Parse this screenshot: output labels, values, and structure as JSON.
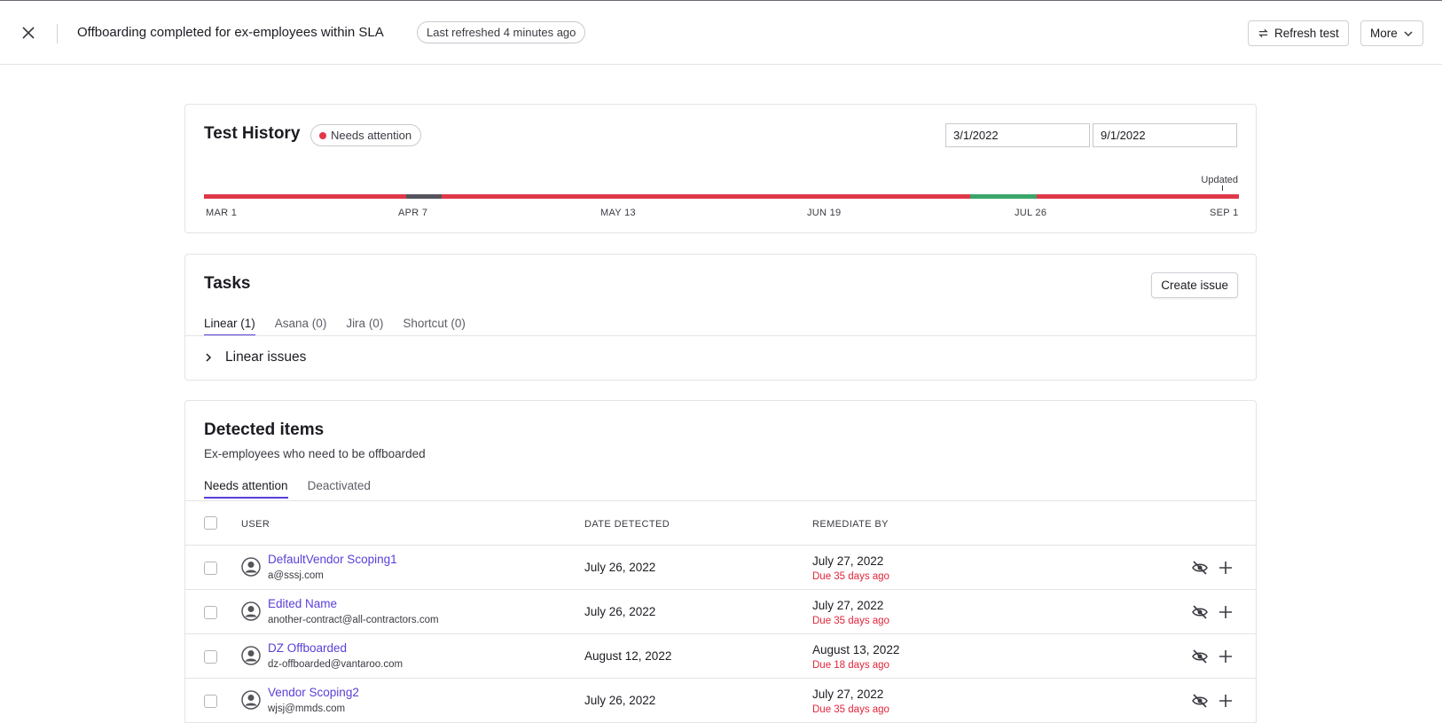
{
  "header": {
    "title": "Offboarding completed for ex-employees within SLA",
    "refresh_status": "Last refreshed 4 minutes ago",
    "refresh_button": "Refresh test",
    "more_button": "More"
  },
  "history": {
    "title": "Test History",
    "status": "Needs attention",
    "start_date": "3/1/2022",
    "end_date": "9/1/2022",
    "updated_label": "Updated",
    "ticks": [
      "MAR 1",
      "APR 7",
      "MAY 13",
      "JUN 19",
      "JUL 26",
      "SEP 1"
    ],
    "segments": [
      {
        "start": 0,
        "end": 0.195,
        "state": "failing"
      },
      {
        "start": 0.195,
        "end": 0.23,
        "state": "unknown"
      },
      {
        "start": 0.23,
        "end": 0.74,
        "state": "failing"
      },
      {
        "start": 0.74,
        "end": 0.805,
        "state": "passing"
      },
      {
        "start": 0.805,
        "end": 1,
        "state": "failing"
      }
    ],
    "colors": {
      "failing": "#e0384a",
      "unknown": "#55545c",
      "passing": "#3aa66a"
    }
  },
  "tasks": {
    "title": "Tasks",
    "create_button": "Create issue",
    "tabs": [
      {
        "label": "Linear (1)",
        "active": true
      },
      {
        "label": "Asana (0)",
        "active": false
      },
      {
        "label": "Jira (0)",
        "active": false
      },
      {
        "label": "Shortcut (0)",
        "active": false
      }
    ],
    "expander_label": "Linear issues"
  },
  "detected": {
    "title": "Detected items",
    "subtitle": "Ex-employees who need to be offboarded",
    "tabs": [
      {
        "label": "Needs attention",
        "active": true
      },
      {
        "label": "Deactivated",
        "active": false
      }
    ],
    "columns": {
      "user": "USER",
      "date": "DATE DETECTED",
      "remediate": "REMEDIATE BY"
    },
    "rows": [
      {
        "name": "DefaultVendor Scoping1",
        "email": "a@sssj.com",
        "date": "July 26, 2022",
        "remediate": "July 27, 2022",
        "due": "Due 35 days ago"
      },
      {
        "name": "Edited Name",
        "email": "another-contract@all-contractors.com",
        "date": "July 26, 2022",
        "remediate": "July 27, 2022",
        "due": "Due 35 days ago"
      },
      {
        "name": "DZ Offboarded",
        "email": "dz-offboarded@vantaroo.com",
        "date": "August 12, 2022",
        "remediate": "August 13, 2022",
        "due": "Due 18 days ago"
      },
      {
        "name": "Vendor Scoping2",
        "email": "wjsj@mmds.com",
        "date": "July 26, 2022",
        "remediate": "July 27, 2022",
        "due": "Due 35 days ago"
      }
    ]
  }
}
